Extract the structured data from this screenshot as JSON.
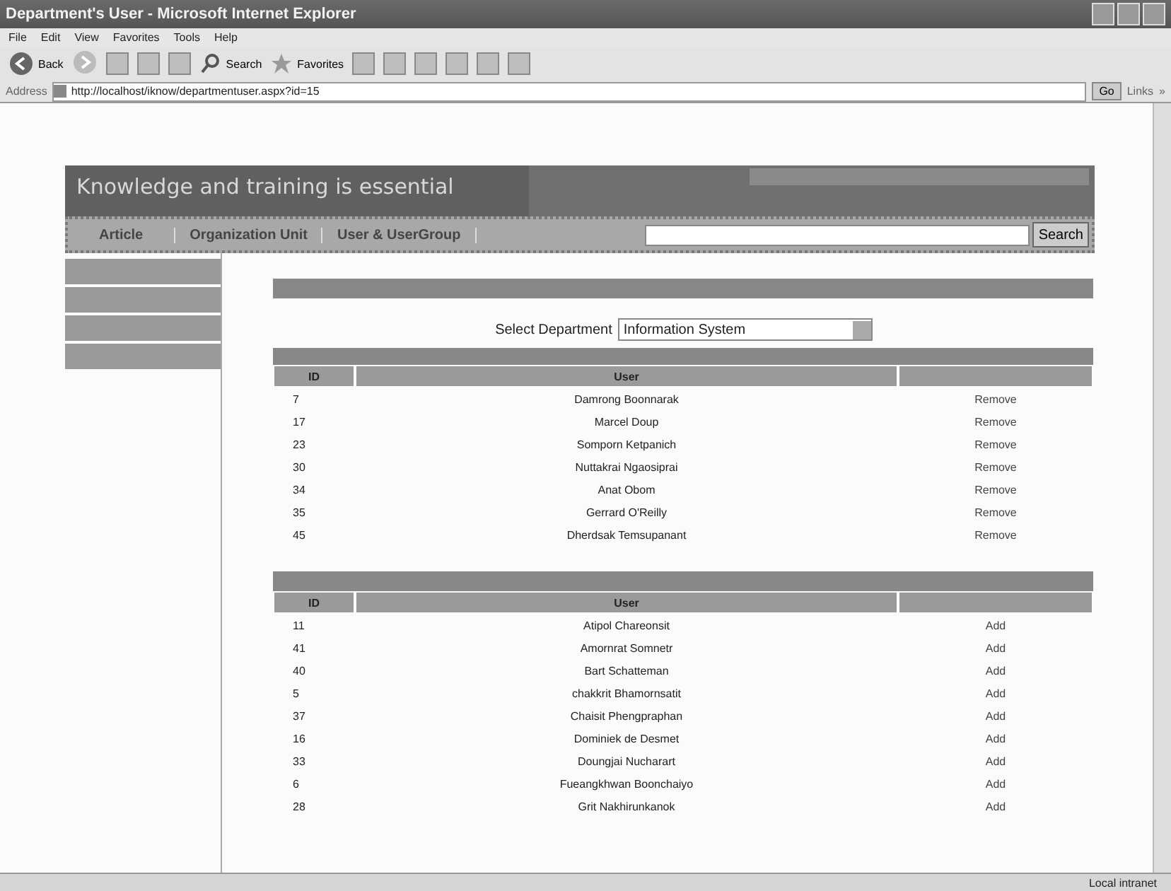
{
  "window": {
    "title": "Department's User - Microsoft Internet Explorer"
  },
  "menu": [
    "File",
    "Edit",
    "View",
    "Favorites",
    "Tools",
    "Help"
  ],
  "toolbar": {
    "back": "Back",
    "search": "Search",
    "favorites": "Favorites"
  },
  "address_bar": {
    "label": "Address",
    "url": "http://localhost/iknow/departmentuser.aspx?id=15",
    "go": "Go",
    "links": "Links",
    "extra": "»"
  },
  "site": {
    "banner": "Knowledge and training is essential",
    "nav": [
      {
        "label": "Article"
      },
      {
        "label": "Organization Unit"
      },
      {
        "label": "User & UserGroup"
      }
    ],
    "search_button": "Search"
  },
  "select": {
    "label": "Select Department",
    "value": "Information System"
  },
  "members": {
    "columns": [
      "ID",
      "User"
    ],
    "rows": [
      {
        "id": "7",
        "name": "Damrong Boonnarak",
        "action": "Remove"
      },
      {
        "id": "17",
        "name": "Marcel Doup",
        "action": "Remove"
      },
      {
        "id": "23",
        "name": "Somporn Ketpanich",
        "action": "Remove"
      },
      {
        "id": "30",
        "name": "Nuttakrai Ngaosiprai",
        "action": "Remove"
      },
      {
        "id": "34",
        "name": "Anat Obom",
        "action": "Remove"
      },
      {
        "id": "35",
        "name": "Gerrard O'Reilly",
        "action": "Remove"
      },
      {
        "id": "45",
        "name": "Dherdsak Temsupanant",
        "action": "Remove"
      }
    ]
  },
  "others": {
    "columns": [
      "ID",
      "User"
    ],
    "rows": [
      {
        "id": "11",
        "name": "Atipol Chareonsit",
        "action": "Add"
      },
      {
        "id": "41",
        "name": "Amornrat Somnetr",
        "action": "Add"
      },
      {
        "id": "40",
        "name": "Bart Schatteman",
        "action": "Add"
      },
      {
        "id": "5",
        "name": "chakkrit Bhamornsatit",
        "action": "Add"
      },
      {
        "id": "37",
        "name": "Chaisit Phengpraphan",
        "action": "Add"
      },
      {
        "id": "16",
        "name": "Dominiek de Desmet",
        "action": "Add"
      },
      {
        "id": "33",
        "name": "Doungjai Nucharart",
        "action": "Add"
      },
      {
        "id": "6",
        "name": "Fueangkhwan Boonchaiyo",
        "action": "Add"
      },
      {
        "id": "28",
        "name": "Grit Nakhirunkanok",
        "action": "Add"
      }
    ]
  },
  "status_bar": {
    "zone": "Local intranet"
  }
}
